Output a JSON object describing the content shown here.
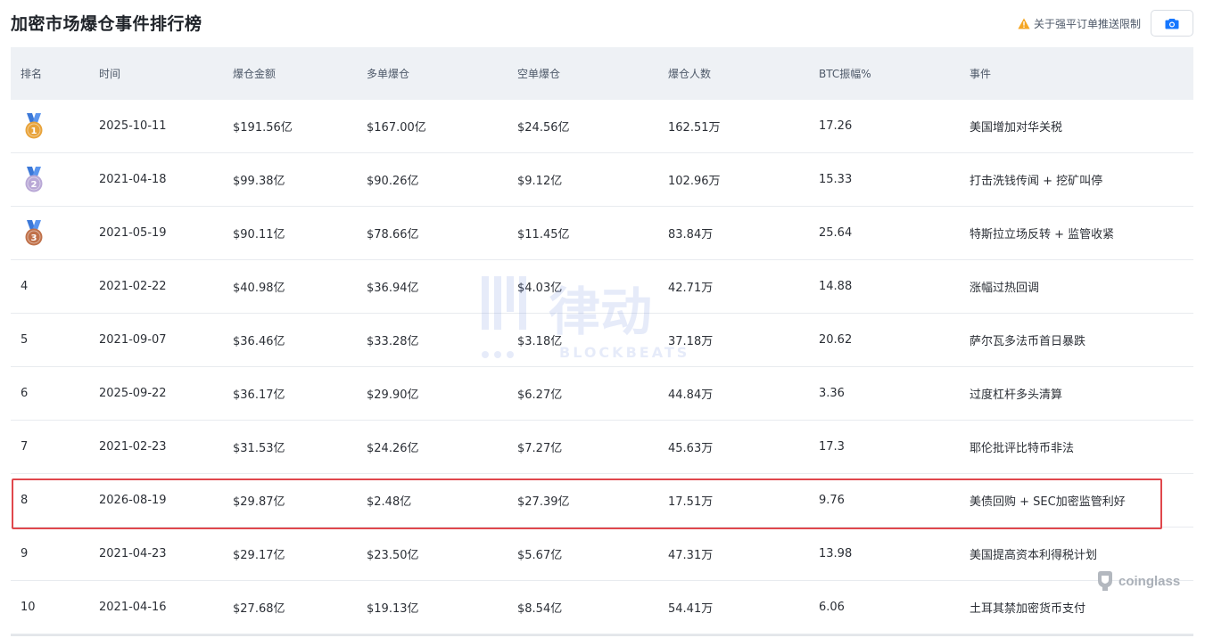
{
  "title": "加密市场爆仓事件排行榜",
  "notice": {
    "text": "关于强平订单推送限制",
    "icon": "warning-icon"
  },
  "camera_button": {
    "icon": "camera-icon"
  },
  "headers": [
    "排名",
    "时间",
    "爆仓金额",
    "多单爆仓",
    "空单爆仓",
    "爆仓人数",
    "BTC振幅%",
    "事件"
  ],
  "rows": [
    {
      "rank": "1",
      "medal": "gold",
      "time": "2025-10-11",
      "total": "$191.56亿",
      "long": "$167.00亿",
      "short": "$24.56亿",
      "people": "162.51万",
      "btc": "17.26",
      "event": "美国增加对华关税"
    },
    {
      "rank": "2",
      "medal": "silver",
      "time": "2021-04-18",
      "total": "$99.38亿",
      "long": "$90.26亿",
      "short": "$9.12亿",
      "people": "102.96万",
      "btc": "15.33",
      "event": "打击洗钱传闻 + 挖矿叫停"
    },
    {
      "rank": "3",
      "medal": "bronze",
      "time": "2021-05-19",
      "total": "$90.11亿",
      "long": "$78.66亿",
      "short": "$11.45亿",
      "people": "83.84万",
      "btc": "25.64",
      "event": "特斯拉立场反转 + 监管收紧"
    },
    {
      "rank": "4",
      "medal": "",
      "time": "2021-02-22",
      "total": "$40.98亿",
      "long": "$36.94亿",
      "short": "$4.03亿",
      "people": "42.71万",
      "btc": "14.88",
      "event": "涨幅过热回调"
    },
    {
      "rank": "5",
      "medal": "",
      "time": "2021-09-07",
      "total": "$36.46亿",
      "long": "$33.28亿",
      "short": "$3.18亿",
      "people": "37.18万",
      "btc": "20.62",
      "event": "萨尔瓦多法币首日暴跌"
    },
    {
      "rank": "6",
      "medal": "",
      "time": "2025-09-22",
      "total": "$36.17亿",
      "long": "$29.90亿",
      "short": "$6.27亿",
      "people": "44.84万",
      "btc": "3.36",
      "event": "过度杠杆多头清算"
    },
    {
      "rank": "7",
      "medal": "",
      "time": "2021-02-23",
      "total": "$31.53亿",
      "long": "$24.26亿",
      "short": "$7.27亿",
      "people": "45.63万",
      "btc": "17.3",
      "event": "耶伦批评比特币非法"
    },
    {
      "rank": "8",
      "medal": "",
      "time": "2026-08-19",
      "total": "$29.87亿",
      "long": "$2.48亿",
      "short": "$27.39亿",
      "people": "17.51万",
      "btc": "9.76",
      "event": "美债回购 + SEC加密监管利好"
    },
    {
      "rank": "9",
      "medal": "",
      "time": "2021-04-23",
      "total": "$29.17亿",
      "long": "$23.50亿",
      "short": "$5.67亿",
      "people": "47.31万",
      "btc": "13.98",
      "event": "美国提高资本利得税计划"
    },
    {
      "rank": "10",
      "medal": "",
      "time": "2021-04-16",
      "total": "$27.68亿",
      "long": "$19.13亿",
      "short": "$8.54亿",
      "people": "54.41万",
      "btc": "6.06",
      "event": "土耳其禁加密货币支付"
    }
  ],
  "highlighted_rank": "8",
  "watermark": {
    "main": "律动",
    "sub": "BLOCKBEATS"
  },
  "branding": {
    "text": "coinglass",
    "icon": "coinglass-logo-icon"
  },
  "colors": {
    "header_bg": "#eef1f5",
    "highlight_border": "#e0474c",
    "accent_blue": "#1677ff",
    "gold": "#e8a33a",
    "silver": "#b9a8d6",
    "bronze": "#c0714a"
  }
}
